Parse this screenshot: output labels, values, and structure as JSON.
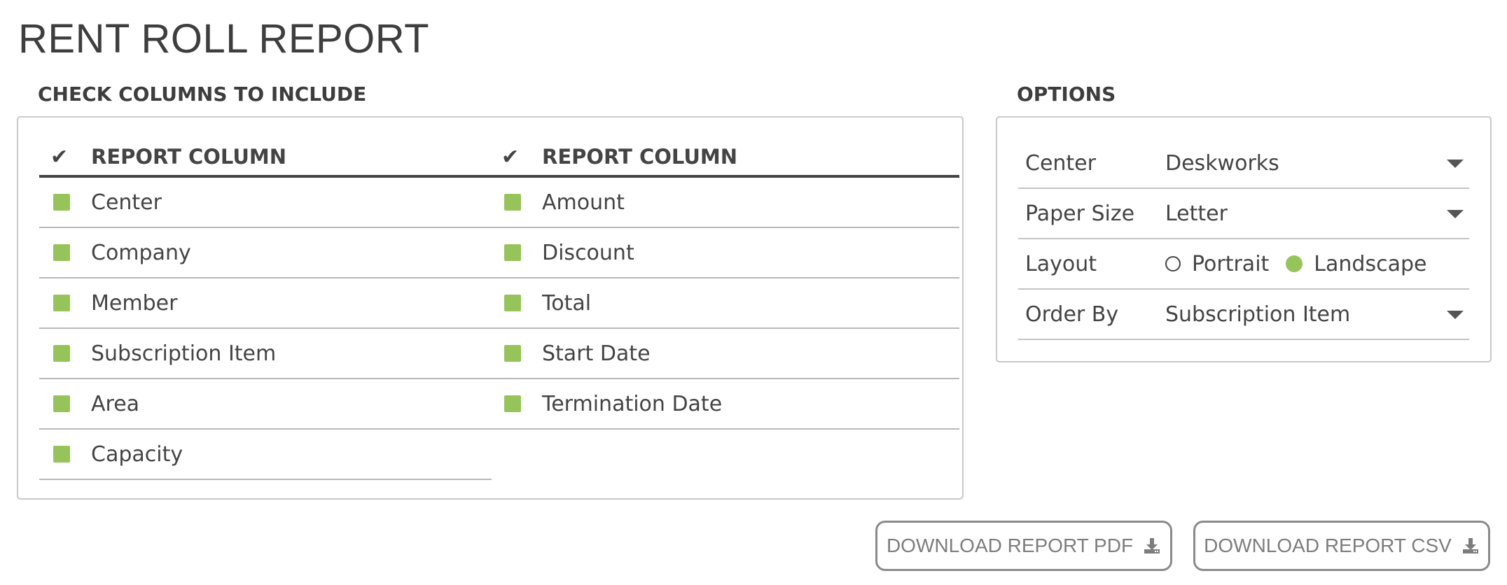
{
  "page": {
    "title": "RENT ROLL REPORT"
  },
  "columns_section": {
    "heading": "CHECK COLUMNS TO INCLUDE",
    "left": {
      "header": "REPORT COLUMN",
      "items": [
        {
          "label": "Center",
          "checked": true
        },
        {
          "label": "Company",
          "checked": true
        },
        {
          "label": "Member",
          "checked": true
        },
        {
          "label": "Subscription Item",
          "checked": true
        },
        {
          "label": "Area",
          "checked": true
        },
        {
          "label": "Capacity",
          "checked": true
        }
      ]
    },
    "right": {
      "header": "REPORT COLUMN",
      "items": [
        {
          "label": "Amount",
          "checked": true
        },
        {
          "label": "Discount",
          "checked": true
        },
        {
          "label": "Total",
          "checked": true
        },
        {
          "label": "Start Date",
          "checked": true
        },
        {
          "label": "Termination Date",
          "checked": true
        }
      ]
    }
  },
  "options_section": {
    "heading": "OPTIONS",
    "center": {
      "label": "Center",
      "value": "Deskworks"
    },
    "paper_size": {
      "label": "Paper Size",
      "value": "Letter"
    },
    "layout": {
      "label": "Layout",
      "portrait": "Portrait",
      "landscape": "Landscape",
      "selected": "Landscape"
    },
    "order_by": {
      "label": "Order By",
      "value": "Subscription Item"
    }
  },
  "actions": {
    "download_pdf": "DOWNLOAD REPORT PDF",
    "download_csv": "DOWNLOAD REPORT CSV"
  },
  "colors": {
    "accent_green": "#97c45a",
    "text": "#444444",
    "border": "#c9c9c9"
  },
  "icons": {
    "header_check": "checkmark-icon",
    "download": "download-icon",
    "dropdown": "caret-down-icon"
  }
}
